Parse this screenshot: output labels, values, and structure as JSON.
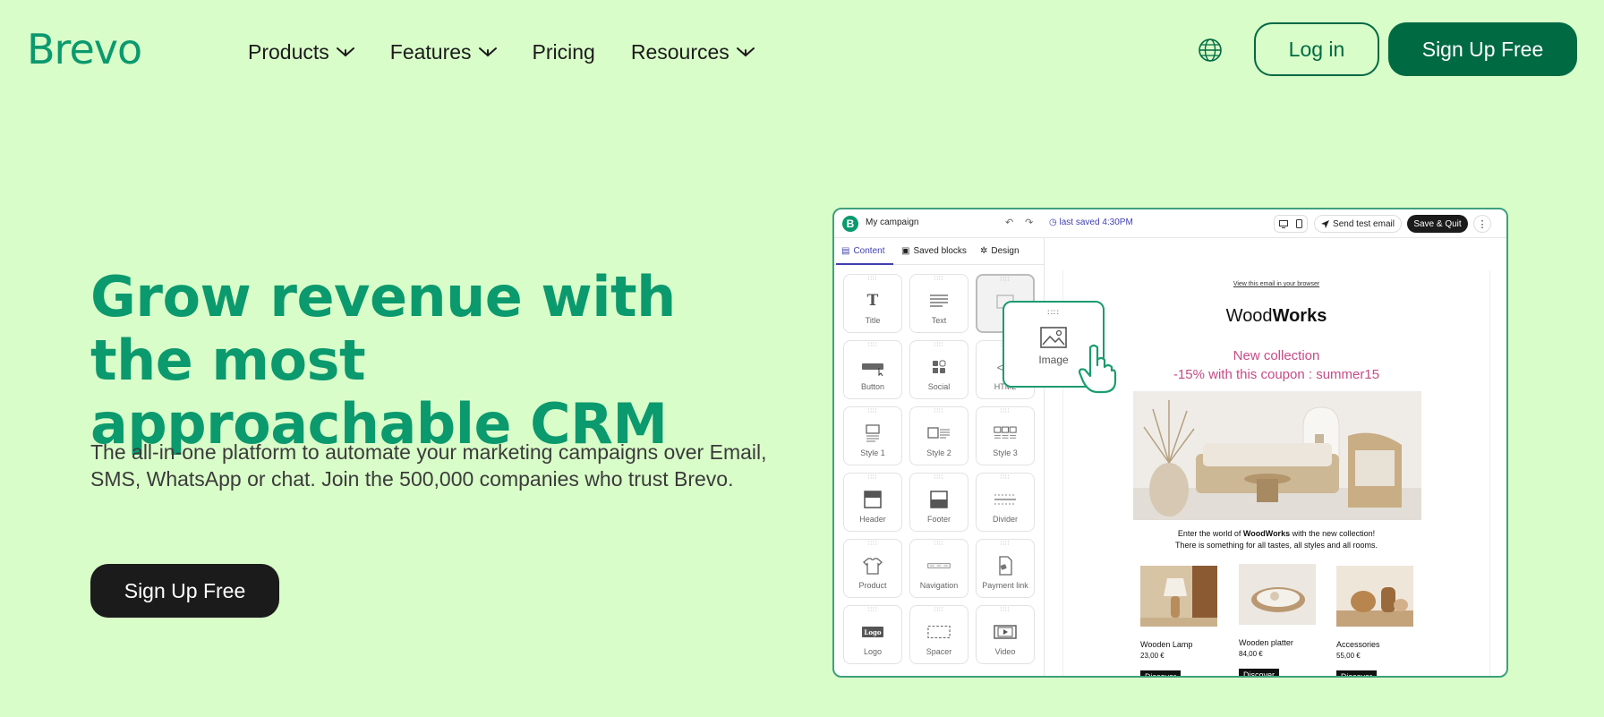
{
  "brand": {
    "logo_text": "Brevo",
    "accent": "#0b996e",
    "dark_green": "#006a43",
    "background": "#d9fdc9"
  },
  "nav": {
    "items": [
      {
        "label": "Products",
        "has_dropdown": true
      },
      {
        "label": "Features",
        "has_dropdown": true
      },
      {
        "label": "Pricing",
        "has_dropdown": false
      },
      {
        "label": "Resources",
        "has_dropdown": true
      }
    ],
    "language_icon": "globe-icon",
    "login_label": "Log in",
    "signup_label": "Sign Up Free"
  },
  "hero": {
    "title": "Grow revenue with the most approachable CRM",
    "subtitle": "The all-in-one platform to automate your marketing campaigns over Email, SMS, WhatsApp or chat. Join the 500,000 companies who trust Brevo.",
    "cta_label": "Sign Up Free"
  },
  "editor": {
    "logo_letter": "B",
    "campaign_name": "My campaign",
    "undo_icon": "↶",
    "redo_icon": "↷",
    "last_saved": "last saved 4:30PM",
    "send_test_label": "Send test email",
    "save_quit_label": "Save & Quit",
    "more_icon": "⋮",
    "tabs": [
      {
        "label": "Content",
        "active": true
      },
      {
        "label": "Saved blocks",
        "active": false
      },
      {
        "label": "Design",
        "active": false
      }
    ],
    "blocks": [
      {
        "label": "Title",
        "icon": "title-icon"
      },
      {
        "label": "Text",
        "icon": "text-icon"
      },
      {
        "label": "",
        "icon": "image-icon"
      },
      {
        "label": "Button",
        "icon": "button-icon"
      },
      {
        "label": "Social",
        "icon": "social-icon"
      },
      {
        "label": "HTML",
        "icon": "html-icon"
      },
      {
        "label": "Style 1",
        "icon": "style1-icon"
      },
      {
        "label": "Style 2",
        "icon": "style2-icon"
      },
      {
        "label": "Style 3",
        "icon": "style3-icon"
      },
      {
        "label": "Header",
        "icon": "header-icon"
      },
      {
        "label": "Footer",
        "icon": "footer-icon"
      },
      {
        "label": "Divider",
        "icon": "divider-icon"
      },
      {
        "label": "Product",
        "icon": "product-icon"
      },
      {
        "label": "Navigation",
        "icon": "navigation-icon"
      },
      {
        "label": "Payment link",
        "icon": "payment-link-icon"
      },
      {
        "label": "Logo",
        "icon": "logo-icon"
      },
      {
        "label": "Spacer",
        "icon": "spacer-icon"
      },
      {
        "label": "Video",
        "icon": "video-icon"
      }
    ],
    "drag_card_label": "Image",
    "email": {
      "view_in_browser": "View this email in your browser",
      "brand_light": "Wood",
      "brand_bold": "Works",
      "headline_1": "New collection",
      "headline_2": "-15% with this coupon : summer15",
      "body_line_1_pre": "Enter the world of ",
      "body_line_1_bold": "WoodWorks",
      "body_line_1_post": " with the new collection!",
      "body_line_2": "There is something for all tastes, all styles and all rooms.",
      "products": [
        {
          "name": "Wooden Lamp",
          "price": "23,00 €",
          "cta": "Discover"
        },
        {
          "name": "Wooden platter",
          "price": "84,00 €",
          "cta": "Discover"
        },
        {
          "name": "Accessories",
          "price": "55,00 €",
          "cta": "Discover"
        }
      ],
      "headline_color": "#c64b86"
    }
  }
}
